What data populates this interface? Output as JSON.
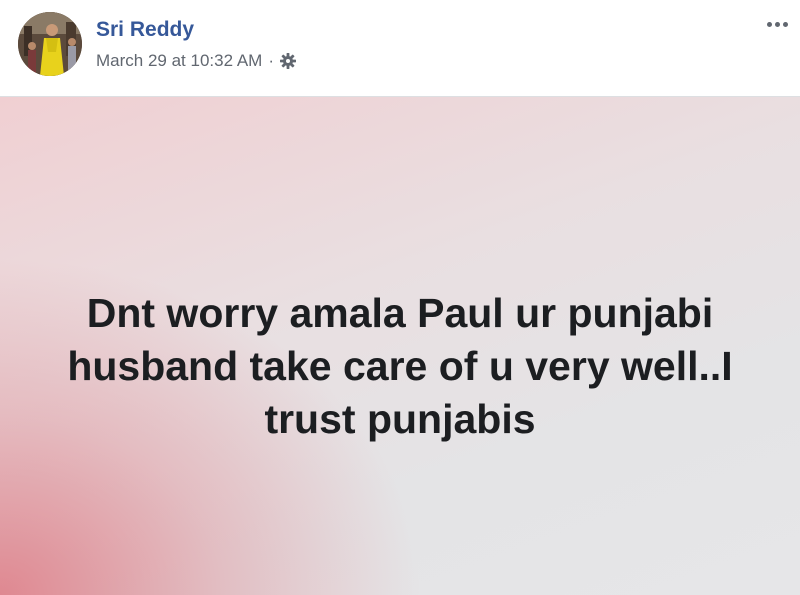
{
  "post": {
    "author": {
      "name": "Sri Reddy",
      "avatar_icon": "profile-photo-icon"
    },
    "timestamp": "March 29 at 10:32 AM",
    "separator": "·",
    "privacy_icon": "gear-icon",
    "menu_icon": "more-options-icon",
    "status_text": "Dnt worry amala Paul ur punjabi husband take care of u very well..I trust punjabis"
  },
  "colors": {
    "author_link": "#365899",
    "meta_text": "#616770",
    "status_text": "#1c1e21",
    "background_pink": "#de7882",
    "background_gray": "#e6e6e8"
  }
}
